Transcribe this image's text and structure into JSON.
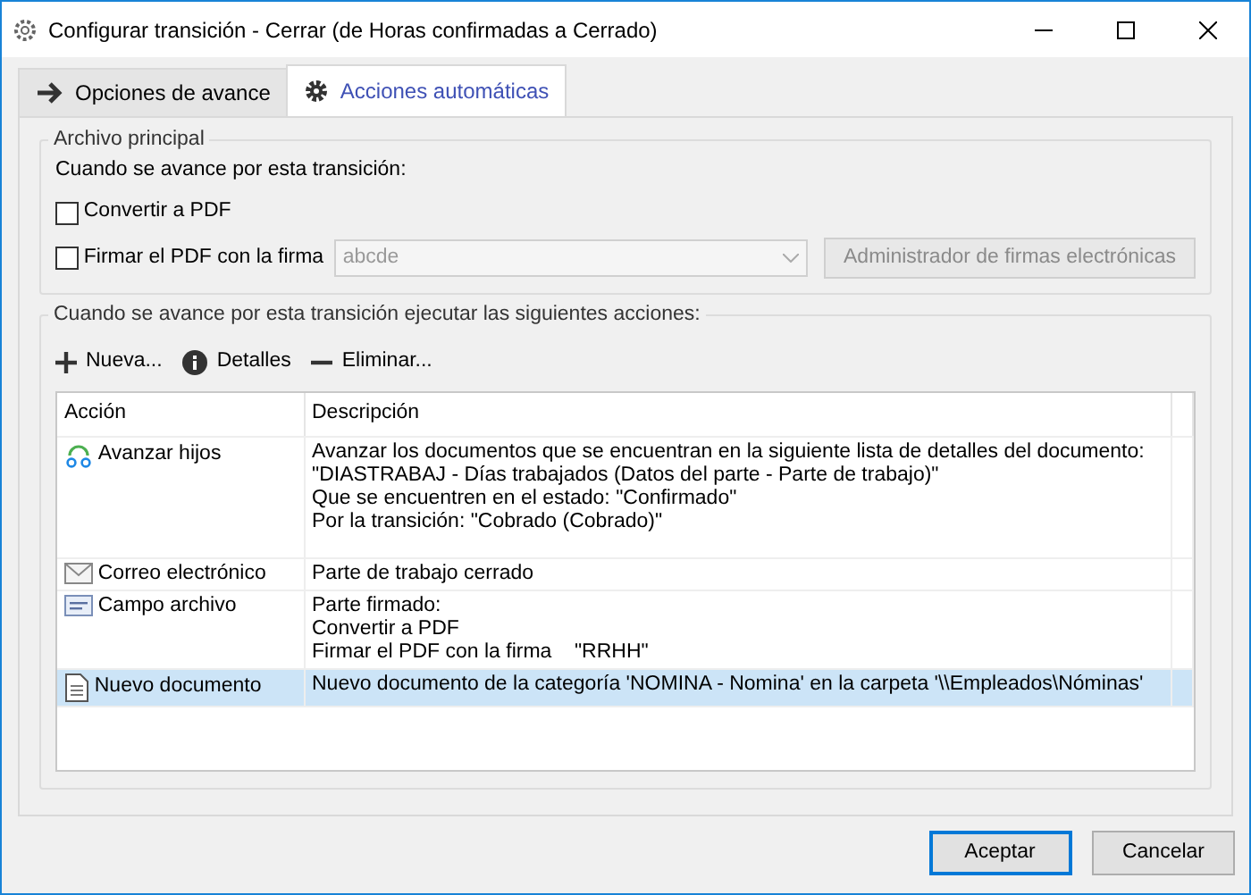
{
  "window": {
    "title": "Configurar transición - Cerrar (de Horas confirmadas a Cerrado)"
  },
  "tabs": [
    {
      "label": "Opciones de avance",
      "kind": "arrow",
      "selected": false
    },
    {
      "label": "Acciones automáticas",
      "kind": "gear",
      "selected": true
    }
  ],
  "main_file": {
    "legend": "Archivo principal",
    "intro": "Cuando se avance por esta transición:",
    "convert_pdf": {
      "label": "Convertir a PDF",
      "checked": false
    },
    "sign_pdf": {
      "label": "Firmar el PDF con la firma",
      "checked": false
    },
    "signature_select": {
      "value": "abcde",
      "disabled": true
    },
    "manager_button": {
      "label": "Administrador de firmas electrónicas",
      "disabled": true
    }
  },
  "actions": {
    "legend": "Cuando se avance por esta transición ejecutar las siguientes acciones:",
    "toolbar": [
      {
        "label": "Nueva...",
        "kind": "plus"
      },
      {
        "label": "Detalles",
        "kind": "info"
      },
      {
        "label": "Eliminar...",
        "kind": "minus"
      }
    ],
    "table": {
      "columns": [
        "Acción",
        "Descripción"
      ],
      "rows": [
        {
          "action": "Avanzar hijos",
          "kind": "advance",
          "selected": false,
          "description": [
            "Avanzar los documentos que se encuentran en la siguiente lista de detalles del documento:",
            "\"DIASTRABAJ - Días trabajados (Datos del parte - Parte de trabajo)\"",
            "Que se encuentren en el estado: \"Confirmado\"",
            "Por la transición: \"Cobrado (Cobrado)\""
          ]
        },
        {
          "action": "Correo electrónico",
          "kind": "email",
          "selected": false,
          "description": [
            "Parte de trabajo cerrado"
          ]
        },
        {
          "action": "Campo archivo",
          "kind": "field",
          "selected": false,
          "description": [
            "Parte firmado:",
            "Convertir a PDF",
            "Firmar el PDF con la firma    \"RRHH\""
          ]
        },
        {
          "action": "Nuevo documento",
          "kind": "document",
          "selected": true,
          "description": [
            "Nuevo documento de la categoría 'NOMINA - Nomina' en la carpeta '\\\\Empleados\\Nóminas'"
          ]
        }
      ]
    }
  },
  "buttons": [
    {
      "label": "Aceptar",
      "kind": "default"
    },
    {
      "label": "Cancelar",
      "kind": "normal"
    }
  ]
}
